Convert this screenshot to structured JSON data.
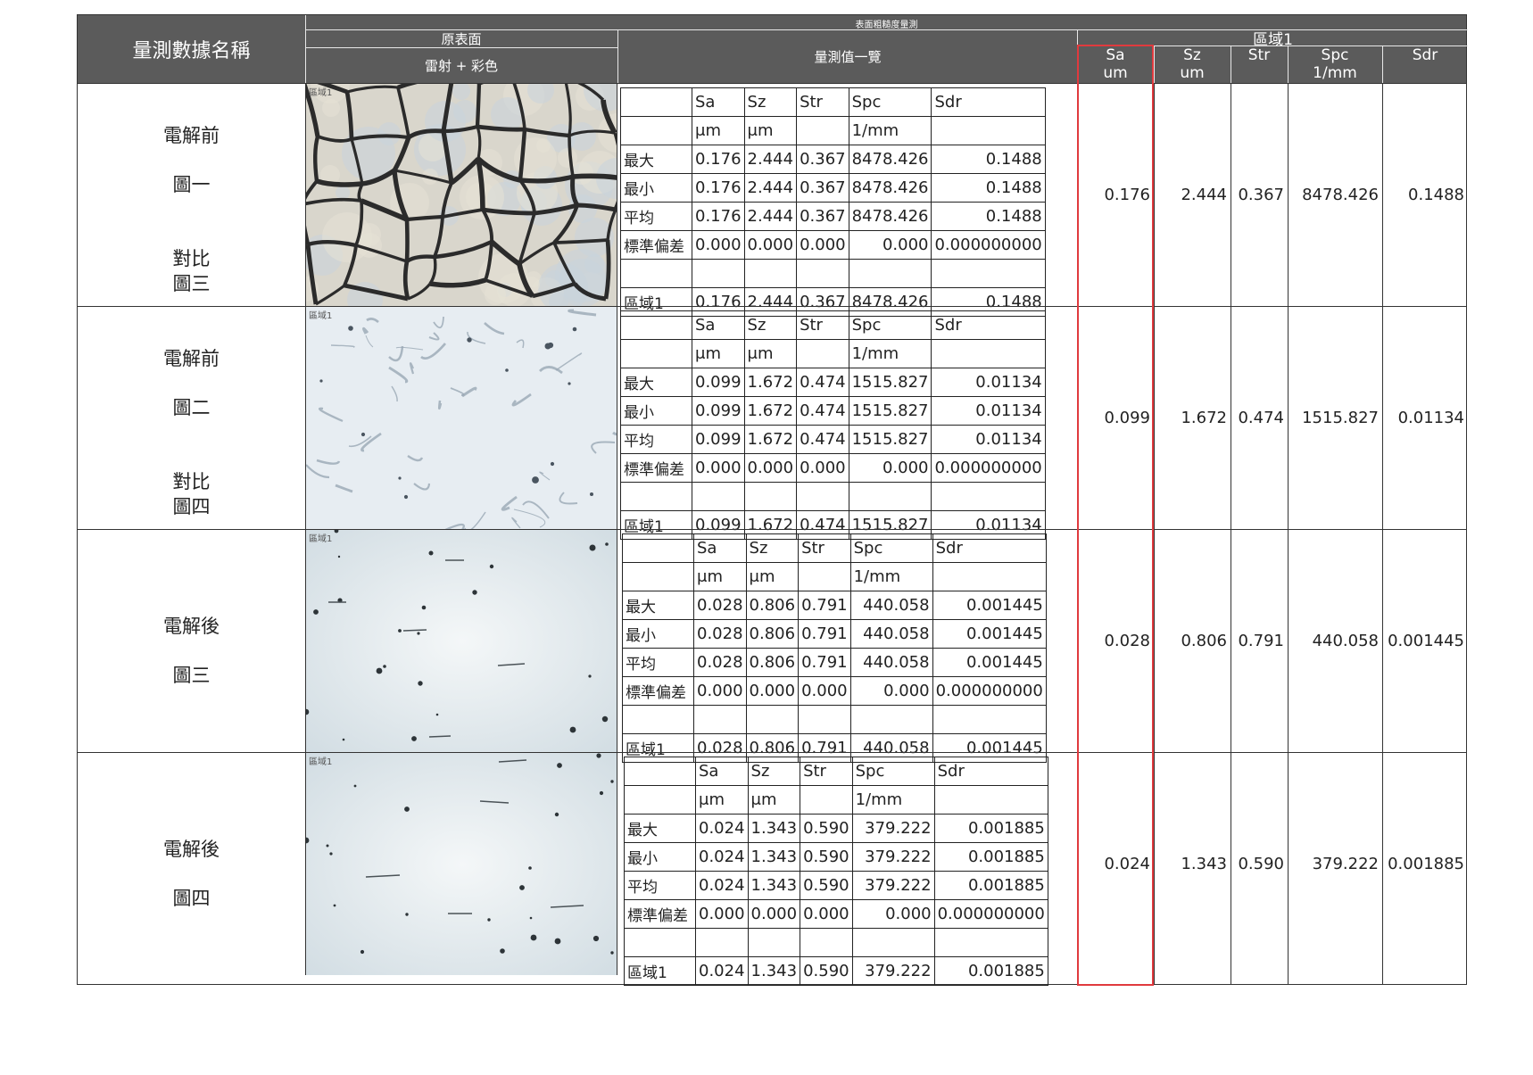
{
  "header": {
    "name_col": "量測數據名稱",
    "super_title": "表面粗糙度量測",
    "original_surface": "原表面",
    "laser_color": "雷射 + 彩色",
    "measurement_list": "量測值一覽",
    "region": "區域1",
    "columns": [
      {
        "key": "Sa",
        "unit": "um"
      },
      {
        "key": "Sz",
        "unit": "um"
      },
      {
        "key": "Str",
        "unit": ""
      },
      {
        "key": "Spc",
        "unit": "1/mm"
      },
      {
        "key": "Sdr",
        "unit": ""
      }
    ]
  },
  "table_headers": [
    "Sa",
    "Sz",
    "Str",
    "Spc",
    "Sdr"
  ],
  "table_units": [
    "μm",
    "μm",
    "",
    "1/mm",
    ""
  ],
  "stat_labels": [
    "最大",
    "最小",
    "平均",
    "標準偏差",
    "",
    "區域1"
  ],
  "photo_label": "區域1",
  "rows": [
    {
      "names": [
        "電解前",
        "圖一",
        "對比",
        "圖三"
      ],
      "stats": [
        [
          "0.176",
          "2.444",
          "0.367",
          "8478.426",
          "0.1488"
        ],
        [
          "0.176",
          "2.444",
          "0.367",
          "8478.426",
          "0.1488"
        ],
        [
          "0.176",
          "2.444",
          "0.367",
          "8478.426",
          "0.1488"
        ],
        [
          "0.000",
          "0.000",
          "0.000",
          "0.000",
          "0.000000000"
        ],
        [
          "",
          "",
          "",
          "",
          ""
        ],
        [
          "0.176",
          "2.444",
          "0.367",
          "8478.426",
          "0.1488"
        ]
      ],
      "summary": [
        "0.176",
        "2.444",
        "0.367",
        "8478.426",
        "0.1488"
      ]
    },
    {
      "names": [
        "電解前",
        "圖二",
        "對比",
        "圖四"
      ],
      "stats": [
        [
          "0.099",
          "1.672",
          "0.474",
          "1515.827",
          "0.01134"
        ],
        [
          "0.099",
          "1.672",
          "0.474",
          "1515.827",
          "0.01134"
        ],
        [
          "0.099",
          "1.672",
          "0.474",
          "1515.827",
          "0.01134"
        ],
        [
          "0.000",
          "0.000",
          "0.000",
          "0.000",
          "0.000000000"
        ],
        [
          "",
          "",
          "",
          "",
          ""
        ],
        [
          "0.099",
          "1.672",
          "0.474",
          "1515.827",
          "0.01134"
        ]
      ],
      "summary": [
        "0.099",
        "1.672",
        "0.474",
        "1515.827",
        "0.01134"
      ]
    },
    {
      "names": [
        "電解後",
        "圖三"
      ],
      "stats": [
        [
          "0.028",
          "0.806",
          "0.791",
          "440.058",
          "0.001445"
        ],
        [
          "0.028",
          "0.806",
          "0.791",
          "440.058",
          "0.001445"
        ],
        [
          "0.028",
          "0.806",
          "0.791",
          "440.058",
          "0.001445"
        ],
        [
          "0.000",
          "0.000",
          "0.000",
          "0.000",
          "0.000000000"
        ],
        [
          "",
          "",
          "",
          "",
          ""
        ],
        [
          "0.028",
          "0.806",
          "0.791",
          "440.058",
          "0.001445"
        ]
      ],
      "summary": [
        "0.028",
        "0.806",
        "0.791",
        "440.058",
        "0.001445"
      ]
    },
    {
      "names": [
        "電解後",
        "圖四"
      ],
      "stats": [
        [
          "0.024",
          "1.343",
          "0.590",
          "379.222",
          "0.001885"
        ],
        [
          "0.024",
          "1.343",
          "0.590",
          "379.222",
          "0.001885"
        ],
        [
          "0.024",
          "1.343",
          "0.590",
          "379.222",
          "0.001885"
        ],
        [
          "0.000",
          "0.000",
          "0.000",
          "0.000",
          "0.000000000"
        ],
        [
          "",
          "",
          "",
          "",
          ""
        ],
        [
          "0.024",
          "1.343",
          "0.590",
          "379.222",
          "0.001885"
        ]
      ],
      "summary": [
        "0.024",
        "1.343",
        "0.590",
        "379.222",
        "0.001885"
      ]
    }
  ],
  "colors": {
    "header_bg": "#5b5b5b",
    "highlight_border": "#e03a3e",
    "grid_line": "#333333"
  }
}
